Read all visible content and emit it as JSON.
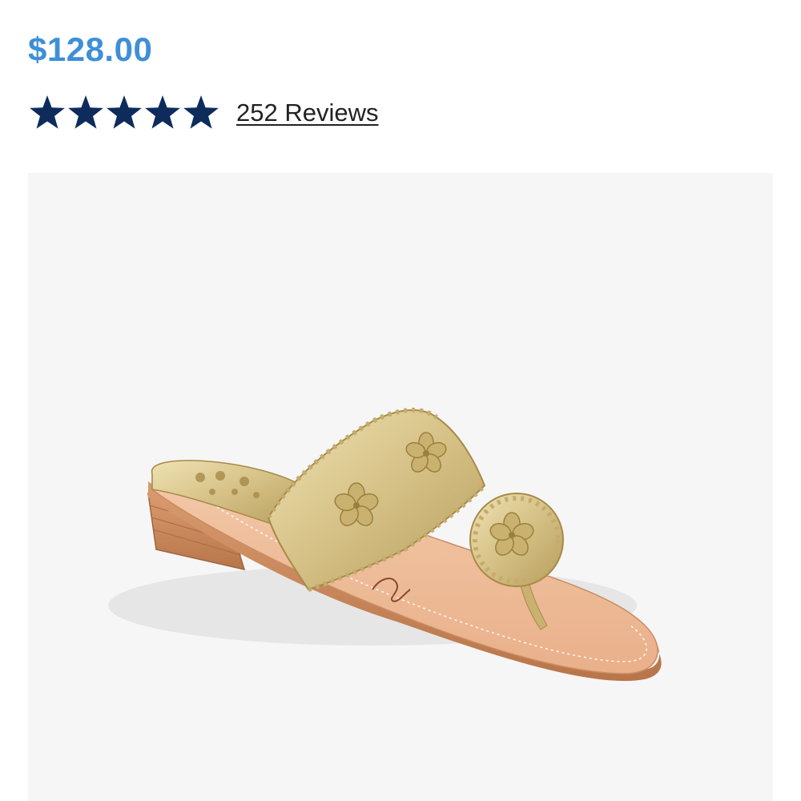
{
  "product": {
    "price": "$128.00",
    "rating": {
      "stars": 5,
      "max_stars": 5,
      "star_color": "#0d2c5c",
      "reviews_label": "252 Reviews"
    },
    "image": {
      "icon": "gold-thong-sandal-image",
      "background_color": "#f6f6f6"
    }
  },
  "colors": {
    "price": "#3f8fd8",
    "text": "#222222"
  }
}
